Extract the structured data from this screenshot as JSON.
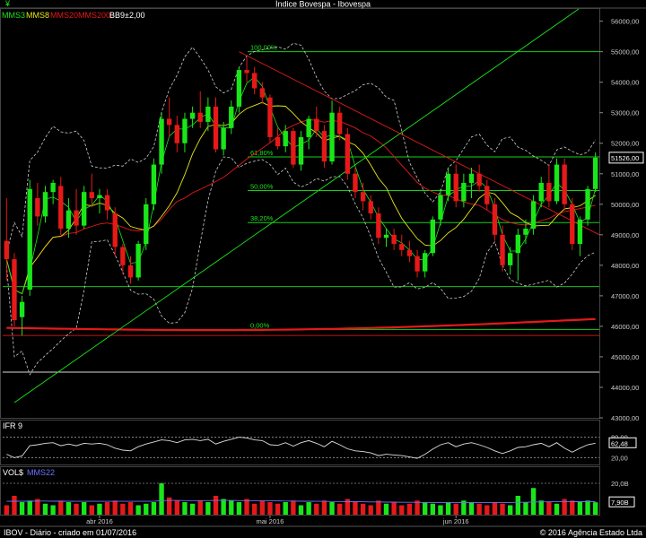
{
  "window": {
    "title": "Índice Bovespa - Ibovespa",
    "footer_left": "IBOV - Diário - criado em 01/07/2016",
    "footer_right": "© 2016 Agência Estado Ltda"
  },
  "legend": {
    "mms3": "MMS3",
    "mms8": "MMS8",
    "mms20": "MMS20",
    "mms200": "MMS200",
    "bb": "BB9±2,00"
  },
  "colors": {
    "up": "#19e619",
    "down": "#e61919",
    "mms3": "#19e619",
    "mms8": "#e6e619",
    "mms20": "#e61919",
    "mms200": "#e61919",
    "bb": "#cccccc",
    "trend": "#19e619",
    "fibo": "#19e619",
    "axis_text": "#cccccc",
    "volume_avg": "#7070ff"
  },
  "chart_data": [
    {
      "type": "candlestick",
      "title": "Índice Bovespa - Ibovespa",
      "ylim": [
        43000,
        56400
      ],
      "y_ticks": [
        "43000,00",
        "44000,00",
        "45000,00",
        "46000,00",
        "47000,00",
        "48000,00",
        "49000,00",
        "50000,00",
        "51000,00",
        "52000,00",
        "53000,00",
        "54000,00",
        "55000,00",
        "56000,00"
      ],
      "last_price_label": "51526,00",
      "x_labels": [
        "abr 2016",
        "mai 2016",
        "jun 2016"
      ],
      "fibonacci": [
        {
          "label": "100,00%",
          "value": 55000
        },
        {
          "label": "61,80%",
          "value": 51550
        },
        {
          "label": "50,00%",
          "value": 50450
        },
        {
          "label": "38,20%",
          "value": 49400
        },
        {
          "label": "0,00%",
          "value": 45900
        }
      ],
      "horizontal_lines": [
        47300,
        45700,
        44500
      ],
      "candles": [
        {
          "o": 48800,
          "h": 50200,
          "l": 47500,
          "c": 48200
        },
        {
          "o": 48200,
          "h": 48400,
          "l": 46000,
          "c": 46200
        },
        {
          "o": 46300,
          "h": 47000,
          "l": 45700,
          "c": 46800
        },
        {
          "o": 47200,
          "h": 50800,
          "l": 47000,
          "c": 50500
        },
        {
          "o": 50200,
          "h": 50700,
          "l": 49300,
          "c": 49600
        },
        {
          "o": 49600,
          "h": 50600,
          "l": 49400,
          "c": 50400
        },
        {
          "o": 50400,
          "h": 50800,
          "l": 50000,
          "c": 50700
        },
        {
          "o": 50600,
          "h": 50900,
          "l": 49000,
          "c": 49200
        },
        {
          "o": 49200,
          "h": 50200,
          "l": 48900,
          "c": 49800
        },
        {
          "o": 49800,
          "h": 50500,
          "l": 49000,
          "c": 49300
        },
        {
          "o": 49300,
          "h": 50600,
          "l": 49200,
          "c": 50400
        },
        {
          "o": 50400,
          "h": 51000,
          "l": 49900,
          "c": 50200
        },
        {
          "o": 50200,
          "h": 50500,
          "l": 49700,
          "c": 50300
        },
        {
          "o": 50300,
          "h": 50500,
          "l": 49500,
          "c": 49800
        },
        {
          "o": 49700,
          "h": 49900,
          "l": 48300,
          "c": 48600
        },
        {
          "o": 48600,
          "h": 48700,
          "l": 47700,
          "c": 48000
        },
        {
          "o": 48000,
          "h": 48300,
          "l": 47400,
          "c": 47600
        },
        {
          "o": 47600,
          "h": 48800,
          "l": 47500,
          "c": 48700
        },
        {
          "o": 48700,
          "h": 50200,
          "l": 48500,
          "c": 50000
        },
        {
          "o": 50000,
          "h": 51500,
          "l": 49800,
          "c": 51300
        },
        {
          "o": 51300,
          "h": 53000,
          "l": 51000,
          "c": 52800
        },
        {
          "o": 52800,
          "h": 53500,
          "l": 52200,
          "c": 52600
        },
        {
          "o": 52600,
          "h": 52900,
          "l": 51700,
          "c": 52000
        },
        {
          "o": 52000,
          "h": 53000,
          "l": 51700,
          "c": 52800
        },
        {
          "o": 52800,
          "h": 53200,
          "l": 52500,
          "c": 53000
        },
        {
          "o": 53000,
          "h": 53700,
          "l": 52500,
          "c": 52700
        },
        {
          "o": 52700,
          "h": 53500,
          "l": 52400,
          "c": 53200
        },
        {
          "o": 53200,
          "h": 53500,
          "l": 51700,
          "c": 51800
        },
        {
          "o": 51800,
          "h": 52700,
          "l": 51600,
          "c": 52500
        },
        {
          "o": 52500,
          "h": 53400,
          "l": 52300,
          "c": 53200
        },
        {
          "o": 53200,
          "h": 54500,
          "l": 53000,
          "c": 54400
        },
        {
          "o": 54400,
          "h": 54800,
          "l": 54000,
          "c": 54300
        },
        {
          "o": 54300,
          "h": 54500,
          "l": 53600,
          "c": 53800
        },
        {
          "o": 53800,
          "h": 54000,
          "l": 53300,
          "c": 53500
        },
        {
          "o": 53500,
          "h": 53600,
          "l": 52000,
          "c": 52200
        },
        {
          "o": 52200,
          "h": 52500,
          "l": 51800,
          "c": 51900
        },
        {
          "o": 51900,
          "h": 52600,
          "l": 51700,
          "c": 52400
        },
        {
          "o": 52400,
          "h": 52500,
          "l": 51200,
          "c": 51300
        },
        {
          "o": 51300,
          "h": 52400,
          "l": 51100,
          "c": 52200
        },
        {
          "o": 52200,
          "h": 52900,
          "l": 51800,
          "c": 52800
        },
        {
          "o": 52800,
          "h": 53200,
          "l": 52200,
          "c": 52400
        },
        {
          "o": 52400,
          "h": 52600,
          "l": 51200,
          "c": 51400
        },
        {
          "o": 51400,
          "h": 53400,
          "l": 51300,
          "c": 53000
        },
        {
          "o": 53000,
          "h": 53200,
          "l": 52100,
          "c": 52300
        },
        {
          "o": 52300,
          "h": 52500,
          "l": 50800,
          "c": 51000
        },
        {
          "o": 51000,
          "h": 51200,
          "l": 50200,
          "c": 50400
        },
        {
          "o": 50400,
          "h": 50700,
          "l": 49800,
          "c": 50100
        },
        {
          "o": 50100,
          "h": 50300,
          "l": 49500,
          "c": 49700
        },
        {
          "o": 49700,
          "h": 49900,
          "l": 48700,
          "c": 48900
        },
        {
          "o": 48900,
          "h": 49200,
          "l": 48600,
          "c": 49000
        },
        {
          "o": 49000,
          "h": 49200,
          "l": 48500,
          "c": 48700
        },
        {
          "o": 48700,
          "h": 49000,
          "l": 48300,
          "c": 48500
        },
        {
          "o": 48500,
          "h": 48800,
          "l": 48100,
          "c": 48300
        },
        {
          "o": 48300,
          "h": 48500,
          "l": 47600,
          "c": 47800
        },
        {
          "o": 47800,
          "h": 48500,
          "l": 47600,
          "c": 48400
        },
        {
          "o": 48400,
          "h": 49600,
          "l": 48300,
          "c": 49500
        },
        {
          "o": 49500,
          "h": 50500,
          "l": 49300,
          "c": 50300
        },
        {
          "o": 50300,
          "h": 51200,
          "l": 50100,
          "c": 51000
        },
        {
          "o": 51000,
          "h": 51300,
          "l": 49900,
          "c": 50100
        },
        {
          "o": 50100,
          "h": 51000,
          "l": 49900,
          "c": 50700
        },
        {
          "o": 50700,
          "h": 51200,
          "l": 50200,
          "c": 51000
        },
        {
          "o": 51000,
          "h": 51300,
          "l": 50400,
          "c": 50600
        },
        {
          "o": 50600,
          "h": 50800,
          "l": 49800,
          "c": 50000
        },
        {
          "o": 50000,
          "h": 50200,
          "l": 48800,
          "c": 49000
        },
        {
          "o": 49000,
          "h": 49300,
          "l": 47800,
          "c": 48000
        },
        {
          "o": 48000,
          "h": 48600,
          "l": 47700,
          "c": 48400
        },
        {
          "o": 48400,
          "h": 49200,
          "l": 47500,
          "c": 49000
        },
        {
          "o": 49000,
          "h": 49500,
          "l": 48700,
          "c": 49200
        },
        {
          "o": 49200,
          "h": 50300,
          "l": 49000,
          "c": 50100
        },
        {
          "o": 50100,
          "h": 50900,
          "l": 49900,
          "c": 50700
        },
        {
          "o": 50700,
          "h": 51300,
          "l": 49900,
          "c": 50100
        },
        {
          "o": 50100,
          "h": 51500,
          "l": 50000,
          "c": 51300
        },
        {
          "o": 51300,
          "h": 51500,
          "l": 49800,
          "c": 50000
        },
        {
          "o": 50000,
          "h": 50200,
          "l": 48500,
          "c": 48700
        },
        {
          "o": 48700,
          "h": 49600,
          "l": 48300,
          "c": 49500
        },
        {
          "o": 49500,
          "h": 50600,
          "l": 49300,
          "c": 50500
        },
        {
          "o": 50500,
          "h": 51700,
          "l": 50400,
          "c": 51526
        }
      ]
    },
    {
      "type": "line",
      "title": "IFR 9",
      "ylim": [
        0,
        100
      ],
      "y_ticks": [
        "80,00",
        "20,00"
      ],
      "last_value_label": "62,48",
      "reference_lines": [
        80,
        20
      ],
      "values": [
        30,
        20,
        25,
        55,
        58,
        62,
        64,
        55,
        60,
        55,
        62,
        60,
        62,
        58,
        48,
        42,
        40,
        52,
        60,
        66,
        72,
        70,
        64,
        72,
        74,
        70,
        74,
        60,
        68,
        74,
        80,
        78,
        72,
        70,
        58,
        56,
        64,
        54,
        64,
        70,
        62,
        52,
        68,
        58,
        46,
        40,
        38,
        34,
        26,
        30,
        28,
        26,
        22,
        18,
        30,
        45,
        58,
        64,
        52,
        60,
        64,
        58,
        50,
        40,
        32,
        40,
        50,
        52,
        58,
        62,
        52,
        64,
        48,
        36,
        48,
        58,
        62.48
      ]
    },
    {
      "type": "bar",
      "title": "VOL$",
      "series_name": "MMS22",
      "ylim": [
        0,
        24
      ],
      "y_ticks": [
        "20,0B"
      ],
      "last_value_label": "7,90B",
      "values": [
        6,
        12,
        8,
        9,
        10,
        7,
        6,
        9,
        8,
        7,
        8,
        6,
        7,
        8,
        9,
        7,
        8,
        6,
        7,
        8,
        20,
        11,
        9,
        8,
        7,
        9,
        8,
        12,
        10,
        9,
        8,
        10,
        7,
        9,
        8,
        7,
        8,
        9,
        6,
        8,
        7,
        9,
        8,
        7,
        10,
        8,
        7,
        6,
        9,
        7,
        8,
        6,
        7,
        9,
        8,
        7,
        6,
        8,
        7,
        9,
        8,
        7,
        6,
        8,
        7,
        6,
        12,
        8,
        17,
        9,
        8,
        7,
        10,
        9,
        8,
        9,
        7.9
      ],
      "moving_average": [
        8.5,
        8.6,
        8.6,
        8.6,
        8.7,
        8.7,
        8.6,
        8.6,
        8.6,
        8.5,
        8.5,
        8.5,
        8.5,
        8.5,
        8.5,
        8.5,
        8.5,
        8.5,
        8.5,
        8.5,
        9.0,
        9.1,
        9.1,
        9.0,
        9.0,
        9.0,
        9.0,
        9.1,
        9.1,
        9.1,
        9.0,
        9.0,
        8.9,
        8.9,
        8.8,
        8.8,
        8.7,
        8.7,
        8.6,
        8.6,
        8.5,
        8.5,
        8.4,
        8.4,
        8.3,
        8.3,
        8.2,
        8.1,
        8.1,
        8.0,
        8.0,
        7.9,
        7.9,
        7.9,
        7.8,
        7.8,
        7.8,
        7.8,
        7.8,
        7.8,
        7.8,
        7.8,
        7.8,
        7.8,
        7.8,
        7.8,
        7.9,
        7.9,
        8.1,
        8.1,
        8.2,
        8.2,
        8.2,
        8.3,
        8.3,
        8.3,
        8.3
      ]
    }
  ]
}
